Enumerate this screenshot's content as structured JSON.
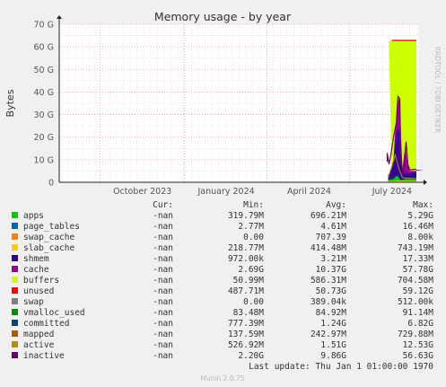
{
  "chart_data": {
    "type": "area",
    "title": "Memory usage - by year",
    "ylabel": "Bytes",
    "xlabel": "",
    "watermark": "RRDTOOL / TOBI OETIKER",
    "footer": "Munin 2.0.75",
    "y_ticks": [
      "0",
      "10 G",
      "20 G",
      "30 G",
      "40 G",
      "50 G",
      "60 G",
      "70 G"
    ],
    "y_tick_values": [
      0,
      10,
      20,
      30,
      40,
      50,
      60,
      70
    ],
    "ylim": [
      0,
      70
    ],
    "y_unit": "GB",
    "x_ticks": [
      "October 2023",
      "January 2024",
      "April 2024",
      "July 2024"
    ],
    "x_tick_dates": [
      "2023-10-01",
      "2024-01-01",
      "2024-04-01",
      "2024-07-01"
    ],
    "xlim": [
      "2023-08-17",
      "2024-09-14"
    ],
    "data_start": "2024-08-12",
    "data_end": "2024-09-12",
    "grid": true,
    "legend_header": [
      "Cur:",
      "Min:",
      "Avg:",
      "Max:"
    ],
    "series": [
      {
        "name": "apps",
        "color": "#00cc00",
        "cur": "-nan",
        "min": "319.79M",
        "avg": "696.21M",
        "max": "5.29G"
      },
      {
        "name": "page_tables",
        "color": "#0066b3",
        "cur": "-nan",
        "min": "2.77M",
        "avg": "4.61M",
        "max": "16.46M"
      },
      {
        "name": "swap_cache",
        "color": "#ff8000",
        "cur": "-nan",
        "min": "0.00",
        "avg": "707.39",
        "max": "8.00k"
      },
      {
        "name": "slab_cache",
        "color": "#ffcc00",
        "cur": "-nan",
        "min": "218.77M",
        "avg": "414.48M",
        "max": "743.19M"
      },
      {
        "name": "shmem",
        "color": "#330099",
        "cur": "-nan",
        "min": "972.00k",
        "avg": "3.21M",
        "max": "17.33M"
      },
      {
        "name": "cache",
        "color": "#990099",
        "cur": "-nan",
        "min": "2.69G",
        "avg": "10.37G",
        "max": "57.78G"
      },
      {
        "name": "buffers",
        "color": "#ccff00",
        "cur": "-nan",
        "min": "50.99M",
        "avg": "586.31M",
        "max": "704.58M"
      },
      {
        "name": "unused",
        "color": "#ff0000",
        "cur": "-nan",
        "min": "487.71M",
        "avg": "50.73G",
        "max": "59.12G"
      },
      {
        "name": "swap",
        "color": "#808080",
        "cur": "-nan",
        "min": "0.00",
        "avg": "389.04k",
        "max": "512.00k"
      },
      {
        "name": "vmalloc_used",
        "color": "#008f00",
        "cur": "-nan",
        "min": "83.48M",
        "avg": "84.92M",
        "max": "91.14M"
      },
      {
        "name": "committed",
        "color": "#00487d",
        "cur": "-nan",
        "min": "777.39M",
        "avg": "1.24G",
        "max": "6.82G"
      },
      {
        "name": "mapped",
        "color": "#b35a00",
        "cur": "-nan",
        "min": "137.59M",
        "avg": "242.97M",
        "max": "729.88M"
      },
      {
        "name": "active",
        "color": "#b38f00",
        "cur": "-nan",
        "min": "526.92M",
        "avg": "1.51G",
        "max": "12.53G"
      },
      {
        "name": "inactive",
        "color": "#6b006b",
        "cur": "-nan",
        "min": "2.20G",
        "avg": "9.86G",
        "max": "56.63G"
      }
    ],
    "last_update": "Last update: Thu Jan  1 01:00:00 1970"
  }
}
